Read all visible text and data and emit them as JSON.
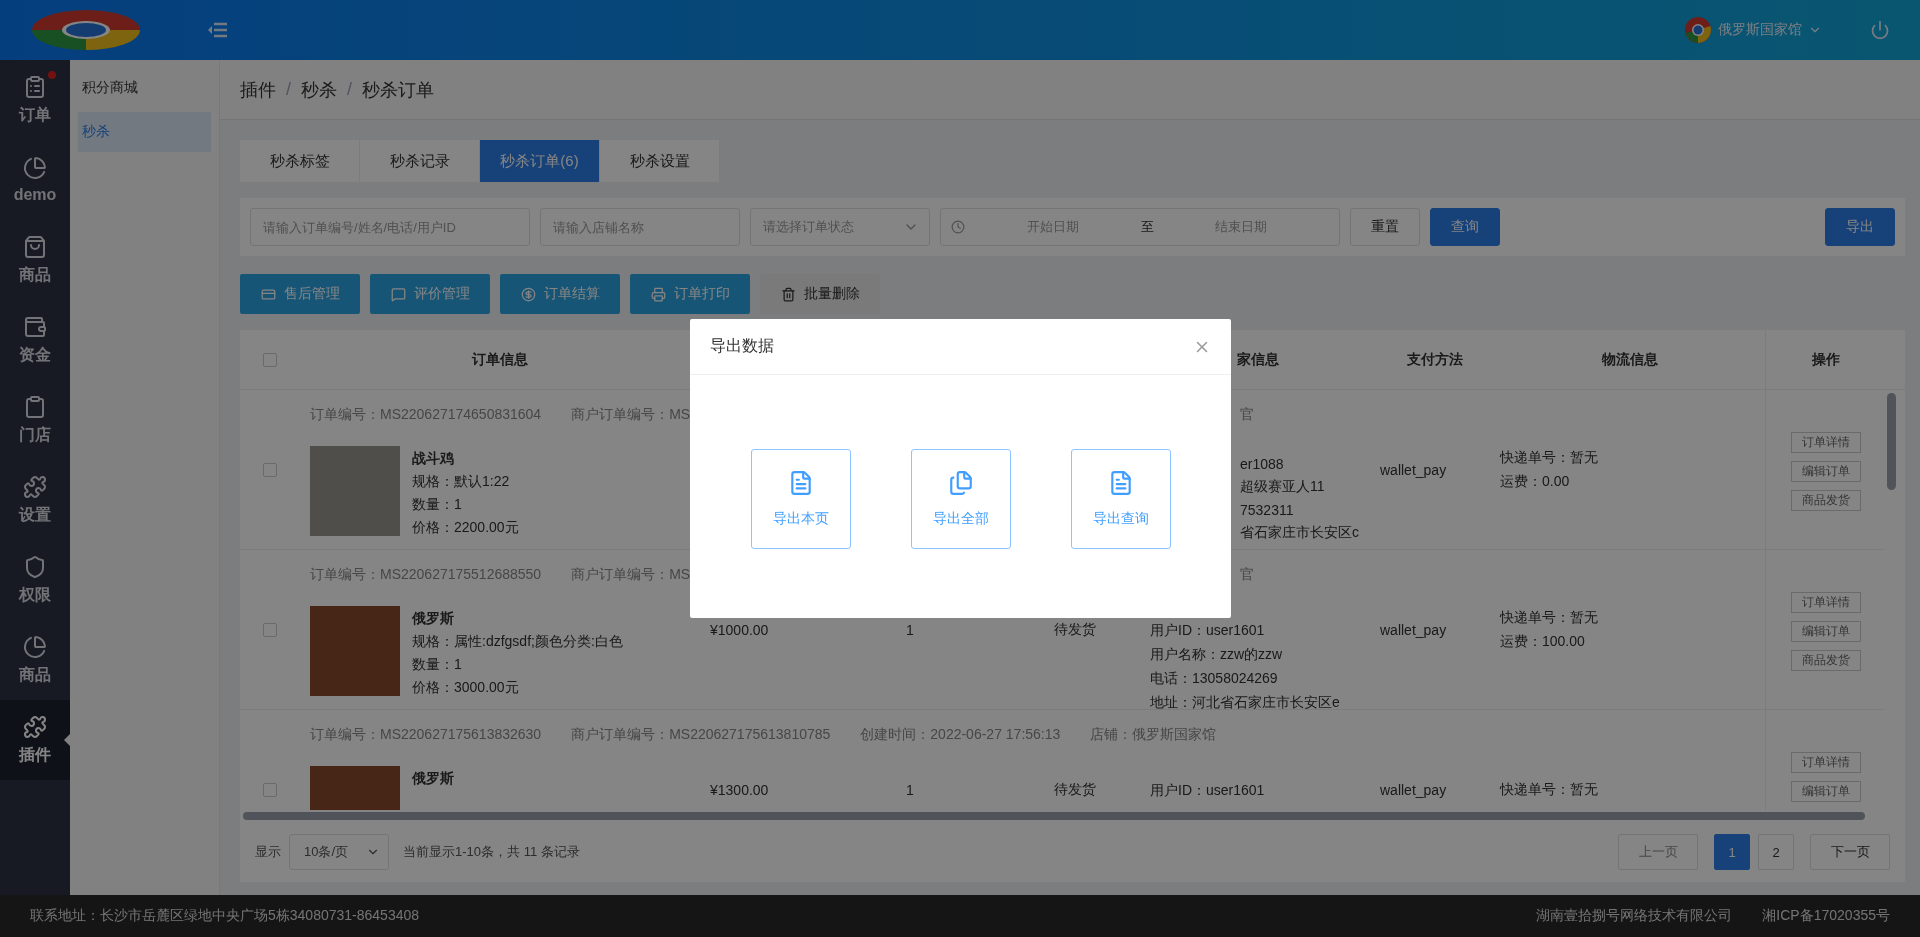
{
  "header": {
    "store_name": "俄罗斯国家馆"
  },
  "nav": [
    {
      "label": "订单",
      "dot": true,
      "selected": false
    },
    {
      "label": "demo",
      "dot": false,
      "selected": false
    },
    {
      "label": "商品",
      "dot": false,
      "selected": false
    },
    {
      "label": "资金",
      "dot": false,
      "selected": false
    },
    {
      "label": "门店",
      "dot": false,
      "selected": false
    },
    {
      "label": "设置",
      "dot": false,
      "selected": false
    },
    {
      "label": "权限",
      "dot": false,
      "selected": false
    },
    {
      "label": "商品",
      "dot": false,
      "selected": false
    },
    {
      "label": "插件",
      "dot": false,
      "selected": true
    }
  ],
  "subnav": [
    {
      "label": "积分商城",
      "selected": false
    },
    {
      "label": "秒杀",
      "selected": true
    }
  ],
  "breadcrumb": [
    "插件",
    "秒杀",
    "秒杀订单"
  ],
  "breadcrumb_separator": "/",
  "tabs": [
    {
      "label": "秒杀标签",
      "selected": false
    },
    {
      "label": "秒杀记录",
      "selected": false
    },
    {
      "label": "秒杀订单(6)",
      "selected": true
    },
    {
      "label": "秒杀设置",
      "selected": false
    }
  ],
  "filters": {
    "order_search": {
      "placeholder": "请输入订单编号/姓名/电话/用户ID"
    },
    "shop_search": {
      "placeholder": "请输入店铺名称"
    },
    "status_select": {
      "placeholder": "请选择订单状态"
    },
    "date_range": {
      "start_placeholder": "开始日期",
      "separator": "至",
      "end_placeholder": "结束日期"
    },
    "reset": "重置",
    "query": "查询",
    "export": "导出"
  },
  "actions": [
    {
      "label": "售后管理",
      "kind": "primary"
    },
    {
      "label": "评价管理",
      "kind": "primary"
    },
    {
      "label": "订单结算",
      "kind": "primary"
    },
    {
      "label": "订单打印",
      "kind": "primary"
    },
    {
      "label": "批量删除",
      "kind": "plain"
    }
  ],
  "table": {
    "select_all": false,
    "columns": {
      "order_info": "订单信息",
      "buyer_info": "家信息",
      "payment": "支付方法",
      "logistics": "物流信息",
      "actions": "操作"
    },
    "rows": [
      {
        "selected": false,
        "order_no": "订单编号：MS220627174650831604",
        "merchant_no": "商户订单编号：MS",
        "shop": "官",
        "product": {
          "name": "战斗鸡",
          "lines": [
            "规格：默认1:22",
            "数量：1",
            "价格：2200.00元"
          ]
        },
        "buyer": [
          "er1088",
          "超级赛亚人11",
          "7532311",
          "省石家庄市长安区c"
        ],
        "payment": "wallet_pay",
        "logistics": [
          "快递单号：暂无",
          "运费：0.00"
        ],
        "operations": [
          "订单详情",
          "编辑订单",
          "商品发货"
        ]
      },
      {
        "selected": false,
        "order_no": "订单编号：MS220627175512688550",
        "merchant_no": "商户订单编号：MS",
        "shop": "官",
        "product": {
          "name": "俄罗斯",
          "lines": [
            "规格：属性:dzfgsdf;颜色分类:白色",
            "数量：1",
            "价格：3000.00元"
          ]
        },
        "price": "¥1000.00",
        "quantity": "1",
        "status": "待发货",
        "buyer": [
          "用户ID：user1601",
          "用户名称：zzw的zzw",
          "电话：13058024269",
          "地址：河北省石家庄市长安区e"
        ],
        "payment": "wallet_pay",
        "logistics": [
          "快递单号：暂无",
          "运费：100.00"
        ],
        "operations": [
          "订单详情",
          "编辑订单",
          "商品发货"
        ]
      },
      {
        "selected": false,
        "order_no": "订单编号：MS220627175613832630",
        "merchant_no": "商户订单编号：MS220627175613810785",
        "created": "创建时间：2022-06-27 17:56:13",
        "shop": "店铺：俄罗斯国家馆",
        "product": {
          "name": "俄罗斯"
        },
        "price": "¥1300.00",
        "quantity": "1",
        "status": "待发货",
        "buyer": [
          "用户ID：user1601"
        ],
        "payment": "wallet_pay",
        "logistics": [
          "快递单号：暂无"
        ],
        "operations": [
          "订单详情",
          "编辑订单"
        ]
      }
    ]
  },
  "pagination": {
    "label": "显示",
    "page_size": "10条/页",
    "summary": "当前显示1-10条，共 11 条记录",
    "prev": {
      "label": "上一页",
      "disabled": true
    },
    "pages": [
      {
        "label": "1",
        "selected": true
      },
      {
        "label": "2",
        "selected": false
      }
    ],
    "next": {
      "label": "下一页",
      "disabled": false
    }
  },
  "footer": {
    "address": "联系地址：长沙市岳麓区绿地中央广场5栋34080731-86453408",
    "company": "湖南壹拾捌号网络技术有限公司",
    "icp": "湘ICP备17020355号"
  },
  "modal": {
    "title": "导出数据",
    "options": [
      {
        "label": "导出本页",
        "kind": "single"
      },
      {
        "label": "导出全部",
        "kind": "multi"
      },
      {
        "label": "导出查询",
        "kind": "single"
      }
    ]
  }
}
